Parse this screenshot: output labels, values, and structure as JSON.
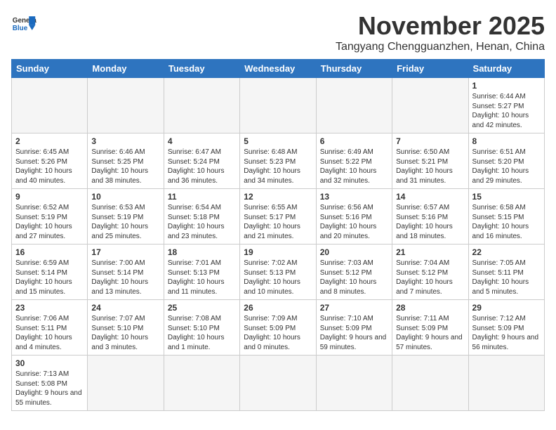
{
  "header": {
    "logo_general": "General",
    "logo_blue": "Blue",
    "month_title": "November 2025",
    "location": "Tangyang Chengguanzhen, Henan, China"
  },
  "weekdays": [
    "Sunday",
    "Monday",
    "Tuesday",
    "Wednesday",
    "Thursday",
    "Friday",
    "Saturday"
  ],
  "weeks": [
    [
      {
        "day": "",
        "info": ""
      },
      {
        "day": "",
        "info": ""
      },
      {
        "day": "",
        "info": ""
      },
      {
        "day": "",
        "info": ""
      },
      {
        "day": "",
        "info": ""
      },
      {
        "day": "",
        "info": ""
      },
      {
        "day": "1",
        "info": "Sunrise: 6:44 AM\nSunset: 5:27 PM\nDaylight: 10 hours and 42 minutes."
      }
    ],
    [
      {
        "day": "2",
        "info": "Sunrise: 6:45 AM\nSunset: 5:26 PM\nDaylight: 10 hours and 40 minutes."
      },
      {
        "day": "3",
        "info": "Sunrise: 6:46 AM\nSunset: 5:25 PM\nDaylight: 10 hours and 38 minutes."
      },
      {
        "day": "4",
        "info": "Sunrise: 6:47 AM\nSunset: 5:24 PM\nDaylight: 10 hours and 36 minutes."
      },
      {
        "day": "5",
        "info": "Sunrise: 6:48 AM\nSunset: 5:23 PM\nDaylight: 10 hours and 34 minutes."
      },
      {
        "day": "6",
        "info": "Sunrise: 6:49 AM\nSunset: 5:22 PM\nDaylight: 10 hours and 32 minutes."
      },
      {
        "day": "7",
        "info": "Sunrise: 6:50 AM\nSunset: 5:21 PM\nDaylight: 10 hours and 31 minutes."
      },
      {
        "day": "8",
        "info": "Sunrise: 6:51 AM\nSunset: 5:20 PM\nDaylight: 10 hours and 29 minutes."
      }
    ],
    [
      {
        "day": "9",
        "info": "Sunrise: 6:52 AM\nSunset: 5:19 PM\nDaylight: 10 hours and 27 minutes."
      },
      {
        "day": "10",
        "info": "Sunrise: 6:53 AM\nSunset: 5:19 PM\nDaylight: 10 hours and 25 minutes."
      },
      {
        "day": "11",
        "info": "Sunrise: 6:54 AM\nSunset: 5:18 PM\nDaylight: 10 hours and 23 minutes."
      },
      {
        "day": "12",
        "info": "Sunrise: 6:55 AM\nSunset: 5:17 PM\nDaylight: 10 hours and 21 minutes."
      },
      {
        "day": "13",
        "info": "Sunrise: 6:56 AM\nSunset: 5:16 PM\nDaylight: 10 hours and 20 minutes."
      },
      {
        "day": "14",
        "info": "Sunrise: 6:57 AM\nSunset: 5:16 PM\nDaylight: 10 hours and 18 minutes."
      },
      {
        "day": "15",
        "info": "Sunrise: 6:58 AM\nSunset: 5:15 PM\nDaylight: 10 hours and 16 minutes."
      }
    ],
    [
      {
        "day": "16",
        "info": "Sunrise: 6:59 AM\nSunset: 5:14 PM\nDaylight: 10 hours and 15 minutes."
      },
      {
        "day": "17",
        "info": "Sunrise: 7:00 AM\nSunset: 5:14 PM\nDaylight: 10 hours and 13 minutes."
      },
      {
        "day": "18",
        "info": "Sunrise: 7:01 AM\nSunset: 5:13 PM\nDaylight: 10 hours and 11 minutes."
      },
      {
        "day": "19",
        "info": "Sunrise: 7:02 AM\nSunset: 5:13 PM\nDaylight: 10 hours and 10 minutes."
      },
      {
        "day": "20",
        "info": "Sunrise: 7:03 AM\nSunset: 5:12 PM\nDaylight: 10 hours and 8 minutes."
      },
      {
        "day": "21",
        "info": "Sunrise: 7:04 AM\nSunset: 5:12 PM\nDaylight: 10 hours and 7 minutes."
      },
      {
        "day": "22",
        "info": "Sunrise: 7:05 AM\nSunset: 5:11 PM\nDaylight: 10 hours and 5 minutes."
      }
    ],
    [
      {
        "day": "23",
        "info": "Sunrise: 7:06 AM\nSunset: 5:11 PM\nDaylight: 10 hours and 4 minutes."
      },
      {
        "day": "24",
        "info": "Sunrise: 7:07 AM\nSunset: 5:10 PM\nDaylight: 10 hours and 3 minutes."
      },
      {
        "day": "25",
        "info": "Sunrise: 7:08 AM\nSunset: 5:10 PM\nDaylight: 10 hours and 1 minute."
      },
      {
        "day": "26",
        "info": "Sunrise: 7:09 AM\nSunset: 5:09 PM\nDaylight: 10 hours and 0 minutes."
      },
      {
        "day": "27",
        "info": "Sunrise: 7:10 AM\nSunset: 5:09 PM\nDaylight: 9 hours and 59 minutes."
      },
      {
        "day": "28",
        "info": "Sunrise: 7:11 AM\nSunset: 5:09 PM\nDaylight: 9 hours and 57 minutes."
      },
      {
        "day": "29",
        "info": "Sunrise: 7:12 AM\nSunset: 5:09 PM\nDaylight: 9 hours and 56 minutes."
      }
    ],
    [
      {
        "day": "30",
        "info": "Sunrise: 7:13 AM\nSunset: 5:08 PM\nDaylight: 9 hours and 55 minutes."
      },
      {
        "day": "",
        "info": ""
      },
      {
        "day": "",
        "info": ""
      },
      {
        "day": "",
        "info": ""
      },
      {
        "day": "",
        "info": ""
      },
      {
        "day": "",
        "info": ""
      },
      {
        "day": "",
        "info": ""
      }
    ]
  ]
}
